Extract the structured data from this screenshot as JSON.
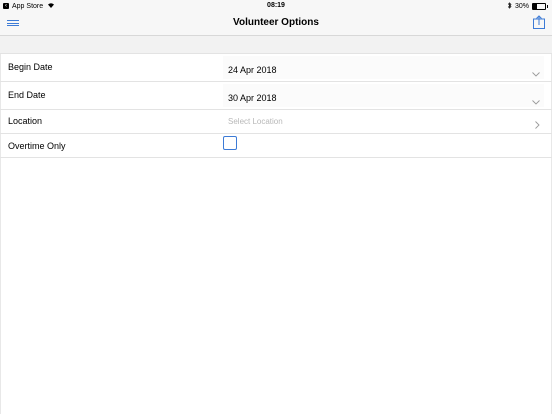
{
  "status_bar": {
    "back_app": "App Store",
    "time": "08:19",
    "battery": "30%",
    "battery_level": 0.3
  },
  "nav": {
    "title": "Volunteer Options"
  },
  "form": {
    "begin_date": {
      "label": "Begin Date",
      "value": "24 Apr 2018"
    },
    "end_date": {
      "label": "End Date",
      "value": "30 Apr 2018"
    },
    "location": {
      "label": "Location",
      "placeholder": "Select Location"
    },
    "overtime": {
      "label": "Overtime Only",
      "checked": false
    }
  },
  "colors": {
    "accent": "#3d7bd6",
    "bar_bg": "#f7f7f7",
    "placeholder": "#b8b8b8"
  },
  "icons": {
    "menu": "hamburger-icon",
    "share": "share-icon",
    "dropdown": "chevron-down-icon",
    "disclosure": "chevron-right-icon"
  }
}
